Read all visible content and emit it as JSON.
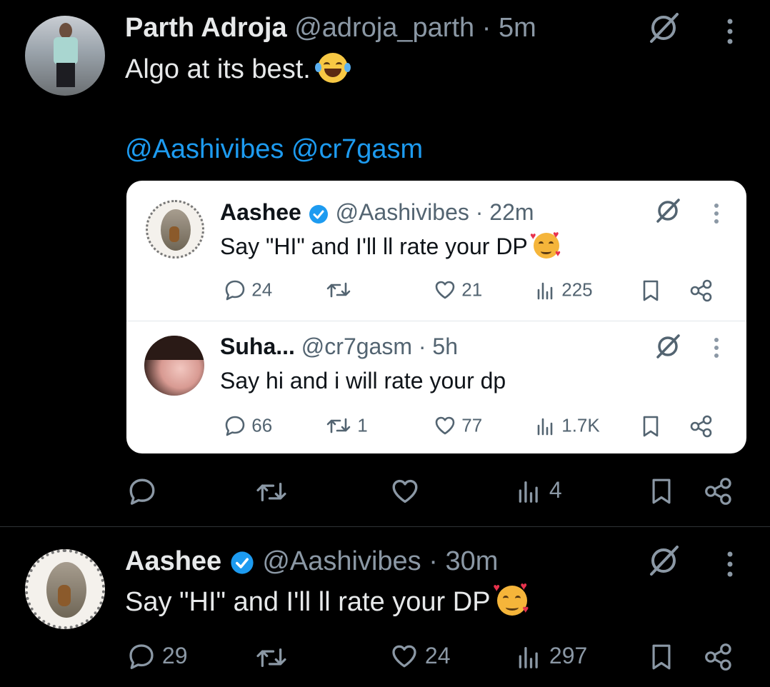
{
  "colors": {
    "background": "#000000",
    "text": "#e7e9ea",
    "muted": "#8b98a5",
    "link": "#1d9bf0",
    "verified": "#1d9bf0",
    "quote_bg": "#ffffff"
  },
  "tweet1": {
    "name": "Parth Adroja",
    "handle": "@adroja_parth",
    "dot": "·",
    "time": "5m",
    "text": "Algo at its best.",
    "mentions": "@Aashivibes @cr7gasm",
    "actions": {
      "views": "4"
    },
    "quote1": {
      "name": "Aashee",
      "handle": "@Aashivibes",
      "dot": "·",
      "time": "22m",
      "text": "Say \"HI\" and I'll ll rate your DP",
      "replies": "24",
      "likes": "21",
      "views": "225"
    },
    "quote2": {
      "name": "Suha...",
      "handle": "@cr7gasm",
      "dot": "·",
      "time": "5h",
      "text": "Say hi and i will rate your dp",
      "replies": "66",
      "retweets": "1",
      "likes": "77",
      "views": "1.7K"
    }
  },
  "tweet2": {
    "name": "Aashee",
    "handle": "@Aashivibes",
    "dot": "·",
    "time": "30m",
    "text": "Say \"HI\" and I'll ll rate your DP",
    "replies": "29",
    "likes": "24",
    "views": "297"
  },
  "icons": [
    "grok-icon",
    "more-icon",
    "reply-icon",
    "retweet-icon",
    "like-icon",
    "views-icon",
    "bookmark-icon",
    "share-icon",
    "verified-icon",
    "laughing-emoji",
    "smiling-hearts-emoji"
  ]
}
